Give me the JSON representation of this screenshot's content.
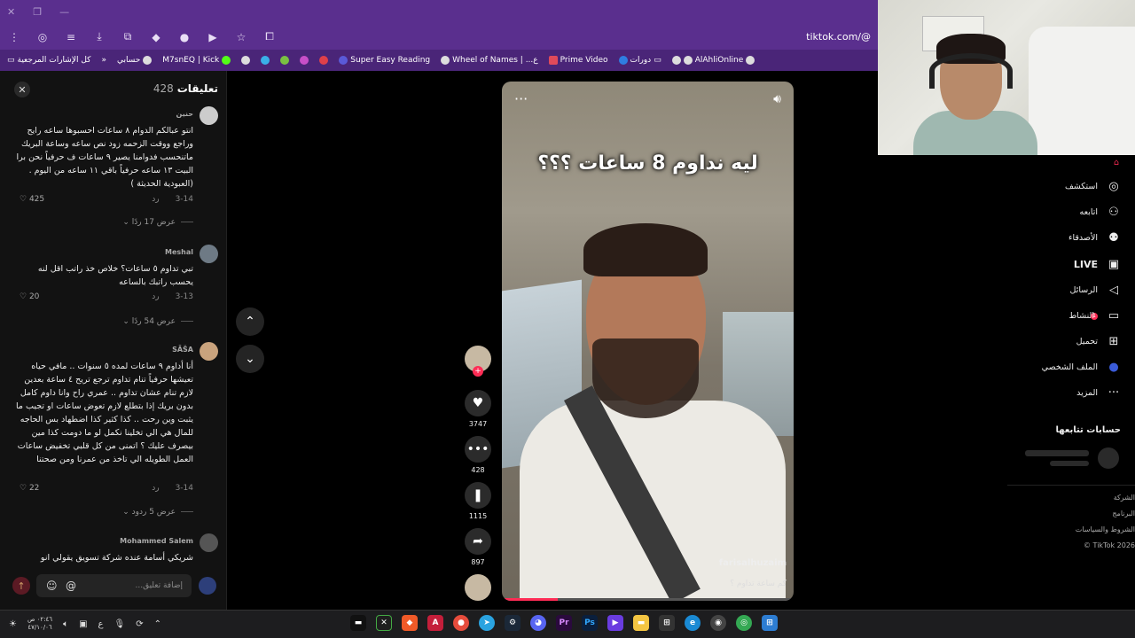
{
  "browser": {
    "url": "tiktok.com/@",
    "bookmarks": [
      "كل الإشارات المرجعية",
      "»",
      "حسابي",
      "M7snEQ | Kick",
      "Super Easy Reading",
      "Wheel of Names | ...ع",
      "Prime Video",
      "دورات",
      "AlAhliOnline"
    ]
  },
  "comments": {
    "title": "تعليقات",
    "count": "428",
    "items": [
      {
        "user": "حنين",
        "text": "انتو عبالكم الدوام ٨ ساعات احسبوها ساعه رايح وراجع ووقت الزحمه زود نص ساعه وساعة البريك ماتنحسب فدوامنا يصير ٩ ساعات ف حرفياً نحن برا البيت ١٣ ساعه حرفياً باقي ١١ ساعه من اليوم . (العبودية الحديثة )",
        "date": "3-14",
        "reply": "رد",
        "likes": "425",
        "replies": "عرض 17 ردًا"
      },
      {
        "user": "Meshal",
        "text": "تبي تداوم ٥ ساعات؟ خلاص خذ راتب اقل لنه يحسب راتبك بالساعه",
        "date": "3-13",
        "reply": "رد",
        "likes": "20",
        "replies": "عرض 54 ردًا"
      },
      {
        "user": "SĀŠA",
        "text": "أنا أداوم ٩ ساعات لمده ٥ سنوات .. مافي حياه تعيشها حرفياً تنام تداوم ترجع تريح ٤ ساعة بعدين لازم تنام عشان تداوم .. عمري راح وانا داوم كامل بدون بريك إذا بتطلع لازم تعوض ساعات او تجيب ما يثبت وين رحت .. كذا كثير كذا اضطهاد بس الحاجه للمال هي الي تخلينا نكمل لو ما دومت كذا مين بيصرف عليك ؟ اتمنى من كل قلبي تخفيض ساعات العمل الطويله الي تاخذ من عمرنا ومن صحتنا",
        "date": "3-14",
        "reply": "رد",
        "likes": "22",
        "replies": "عرض 5 ردود"
      },
      {
        "user": "Mohammed Salem",
        "text": "شريكي أسامة عنده شركة تسويق يقولي انو"
      }
    ],
    "input_placeholder": "إضافة تعليق..."
  },
  "video": {
    "caption": "ليه نداوم 8 ساعات ؟؟؟",
    "author": "farisalhuzaim",
    "description": "كم ساعة تداوم ؟",
    "progress": 0.19
  },
  "actions": {
    "likes": "3747",
    "comments": "428",
    "saves": "1115",
    "shares": "897"
  },
  "sidebar": {
    "items": [
      "استكشف",
      "اتابعه",
      "الأصدقاء",
      "LIVE",
      "الرسائل",
      "النشاط",
      "تحميل",
      "الملف الشخصي",
      "المزيد"
    ],
    "activity_badge": "1",
    "following_title": "حسابات تتابعها",
    "footer": [
      "الشركة",
      "البرنامج",
      "الشروط والسياسات",
      "TikTok 2026 ©"
    ]
  },
  "taskbar": {
    "time": "٠٢:٤٦ ص",
    "date": "٤٧/١٠/٠٦",
    "lang": "ع"
  }
}
